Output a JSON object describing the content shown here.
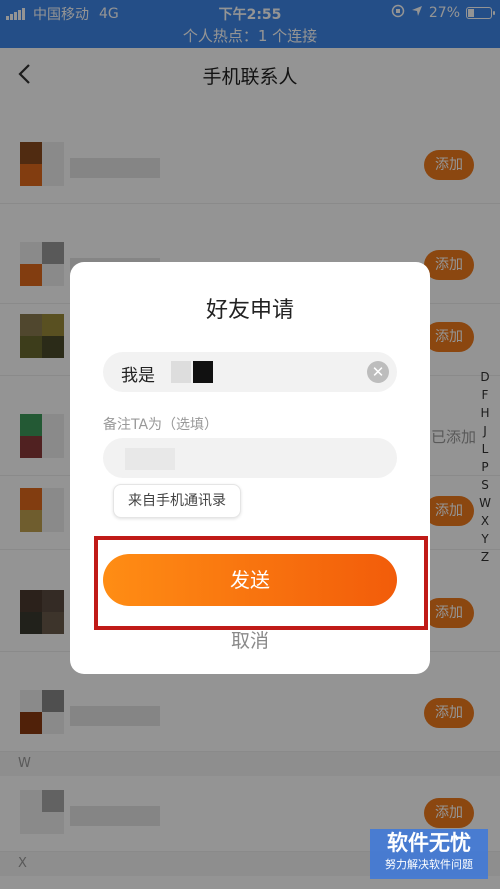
{
  "status_bar": {
    "carrier": "中国移动",
    "network": "4G",
    "time": "下午2:55",
    "battery": "27%",
    "battery_level": 0.27
  },
  "hotspot_banner": "个人热点：1 个连接",
  "nav": {
    "title": "手机联系人",
    "back_icon": "chevron-left-icon"
  },
  "contacts": {
    "add_label": "添加",
    "added_label": "已添加",
    "section_w": "W",
    "section_x": "X"
  },
  "index_letters": [
    "D",
    "F",
    "H",
    "J",
    "L",
    "P",
    "S",
    "W",
    "X",
    "Y",
    "Z"
  ],
  "dialog": {
    "title": "好友申请",
    "message_prefix": "我是",
    "remark_label": "备注TA为（选填）",
    "source_chip": "来自手机通讯录",
    "send_label": "发送",
    "cancel_label": "取消",
    "clear_icon": "close-circle-icon"
  },
  "watermark": {
    "title": "软件无忧",
    "subtitle": "努力解决软件问题"
  },
  "colors": {
    "accent": "#f07a1c",
    "status_bar": "#3f87e8",
    "highlight": "#c01a17"
  }
}
